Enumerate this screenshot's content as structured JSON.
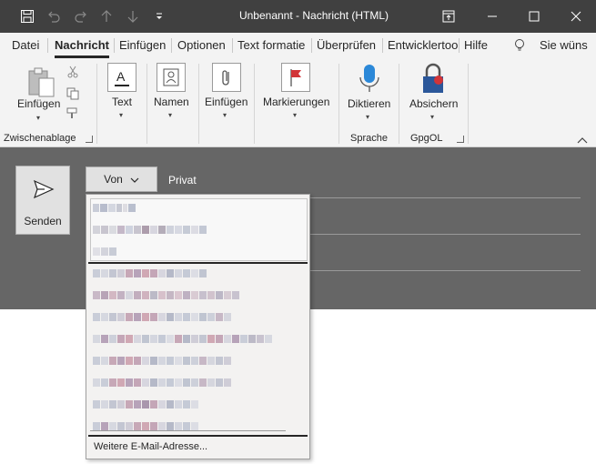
{
  "window": {
    "title": "Unbenannt  -  Nachricht (HTML)",
    "controls": [
      "restore-icon",
      "minimize-icon",
      "maximize-icon",
      "close-icon"
    ]
  },
  "quick_access": [
    "save-icon",
    "undo-icon",
    "redo-icon",
    "up-arrow-icon",
    "down-arrow-icon",
    "customize-icon"
  ],
  "tabs": [
    {
      "label": "Datei"
    },
    {
      "label": "Nachricht",
      "active": true
    },
    {
      "label": "Einfügen"
    },
    {
      "label": "Optionen"
    },
    {
      "label": "Text formatie"
    },
    {
      "label": "Überprüfen"
    },
    {
      "label": "Entwicklertoo"
    },
    {
      "label": "Hilfe"
    }
  ],
  "tell_me": "Sie wüns",
  "ribbon": {
    "clipboard": {
      "paste": "Einfügen",
      "group": "Zwischenablage"
    },
    "text": "Text",
    "names": "Namen",
    "insert": "Einfügen",
    "tags": "Markierungen",
    "dictate": "Diktieren",
    "speech_group": "Sprache",
    "protect": "Absichern",
    "gpg_group": "GpgOL"
  },
  "compose": {
    "send": "Senden",
    "from": "Von",
    "from_account": "Privat"
  },
  "dropdown": {
    "more": "Weitere E-Mail-Adresse..."
  },
  "colors": {
    "titlebar": "#404040",
    "ribbon": "#f3f3f3",
    "compose_bg": "#666666",
    "accent_red": "#d13438",
    "accent_blue": "#2b579a"
  }
}
